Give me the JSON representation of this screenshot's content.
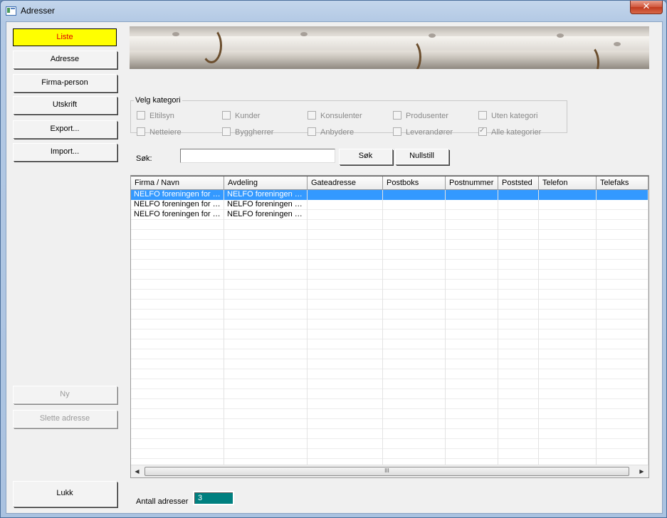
{
  "window": {
    "title": "Adresser",
    "close_label": "✕"
  },
  "nav": {
    "liste": "Liste",
    "adresse": "Adresse",
    "firma_person": "Firma-person",
    "utskrift": "Utskrift",
    "export": "Export...",
    "import": "Import...",
    "ny": "Ny",
    "slette": "Slette adresse",
    "lukk": "Lukk"
  },
  "category": {
    "legend": "Velg kategori",
    "items": [
      {
        "label": "Eltilsyn",
        "checked": false
      },
      {
        "label": "Kunder",
        "checked": false
      },
      {
        "label": "Konsulenter",
        "checked": false
      },
      {
        "label": "Produsenter",
        "checked": false
      },
      {
        "label": "Uten kategori",
        "checked": false
      },
      {
        "label": "Netteiere",
        "checked": false
      },
      {
        "label": "Byggherrer",
        "checked": false
      },
      {
        "label": "Anbydere",
        "checked": false
      },
      {
        "label": "Leverandører",
        "checked": false
      },
      {
        "label": "Alle kategorier",
        "checked": true
      }
    ]
  },
  "search": {
    "label": "Søk:",
    "value": "",
    "search_button": "Søk",
    "reset_button": "Nullstill"
  },
  "table": {
    "columns": [
      "Firma / Navn",
      "Avdeling",
      "Gateadresse",
      "Postboks",
      "Postnummer",
      "Poststed",
      "Telefon",
      "Telefaks"
    ],
    "rows": [
      [
        "NELFO foreningen for …",
        "NELFO foreningen …",
        "",
        "",
        "",
        "",
        "",
        ""
      ],
      [
        "NELFO foreningen for …",
        "NELFO foreningen …",
        "",
        "",
        "",
        "",
        "",
        ""
      ],
      [
        "NELFO foreningen for …",
        "NELFO foreningen …",
        "",
        "",
        "",
        "",
        "",
        ""
      ]
    ],
    "selected_row": 0,
    "scroll_grip": "III",
    "scroll_left": "◀",
    "scroll_right": "▶"
  },
  "footer": {
    "count_label": "Antall adresser",
    "count_value": "3"
  },
  "colors": {
    "active_nav_bg": "#ffff00",
    "active_nav_text": "#e00000",
    "selection": "#3399ff",
    "count_bg": "#008080"
  }
}
